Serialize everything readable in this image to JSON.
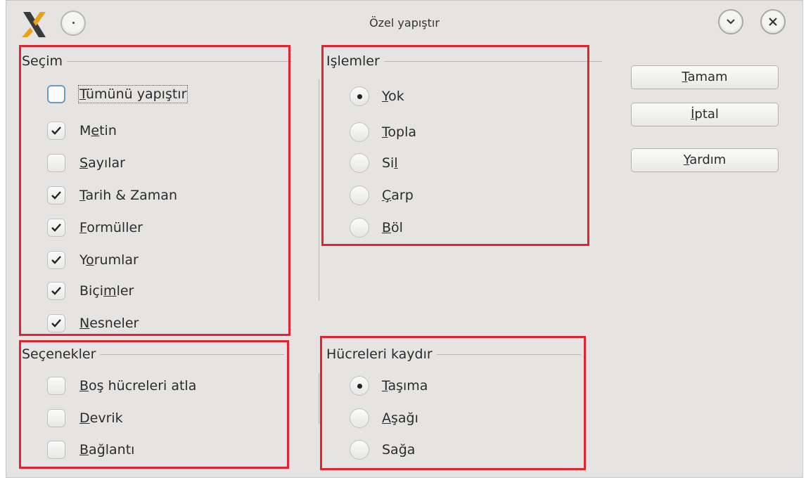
{
  "window": {
    "title": "Özel yapıştır"
  },
  "selection": {
    "title": "Seçim",
    "items": [
      {
        "pre": "",
        "u": "T",
        "post": "ümünü yapıştır",
        "checked": false,
        "focused": true
      },
      {
        "pre": "M",
        "u": "e",
        "post": "tin",
        "checked": true
      },
      {
        "pre": "",
        "u": "S",
        "post": "ayılar",
        "checked": false
      },
      {
        "pre": "",
        "u": "T",
        "post": "arih & Zaman",
        "checked": true
      },
      {
        "pre": "",
        "u": "F",
        "post": "ormüller",
        "checked": true
      },
      {
        "pre": "Y",
        "u": "o",
        "post": "rumlar",
        "checked": true
      },
      {
        "pre": "Biçi",
        "u": "m",
        "post": "ler",
        "checked": true
      },
      {
        "pre": "",
        "u": "N",
        "post": "esneler",
        "checked": true
      }
    ]
  },
  "operations": {
    "title": "Işlemler",
    "items": [
      {
        "pre": "",
        "u": "Y",
        "post": "ok",
        "selected": true
      },
      {
        "pre": "",
        "u": "T",
        "post": "opla",
        "selected": false
      },
      {
        "pre": "Si",
        "u": "l",
        "post": "",
        "selected": false
      },
      {
        "pre": "",
        "u": "Ç",
        "post": "arp",
        "selected": false
      },
      {
        "pre": "",
        "u": "B",
        "post": "öl",
        "selected": false
      }
    ]
  },
  "options": {
    "title": "Seçenekler",
    "items": [
      {
        "pre": "",
        "u": "B",
        "post": "oş hücreleri atla",
        "checked": false
      },
      {
        "pre": "",
        "u": "D",
        "post": "evrik",
        "checked": false
      },
      {
        "pre": "",
        "u": "B",
        "post": "ağlantı",
        "checked": false
      }
    ]
  },
  "shift": {
    "title": "Hücreleri kaydır",
    "items": [
      {
        "pre": "",
        "u": "T",
        "post": "aşıma",
        "selected": true
      },
      {
        "pre": "",
        "u": "A",
        "post": "şağı",
        "selected": false
      },
      {
        "pre": "Sa",
        "u": "ğ",
        "post": "a",
        "selected": false
      }
    ]
  },
  "buttons": {
    "ok": {
      "pre": "",
      "u": "T",
      "post": "amam"
    },
    "cancel": {
      "pre": "",
      "u": "İ",
      "post": "ptal"
    },
    "help": {
      "pre": "",
      "u": "Y",
      "post": "ardım"
    }
  },
  "colors": {
    "highlight": "#e3232f",
    "background": "#e5e4e2"
  },
  "icons": [
    "app-logo-icon",
    "window-menu-icon",
    "minimize-icon",
    "close-icon",
    "checkmark-icon"
  ]
}
